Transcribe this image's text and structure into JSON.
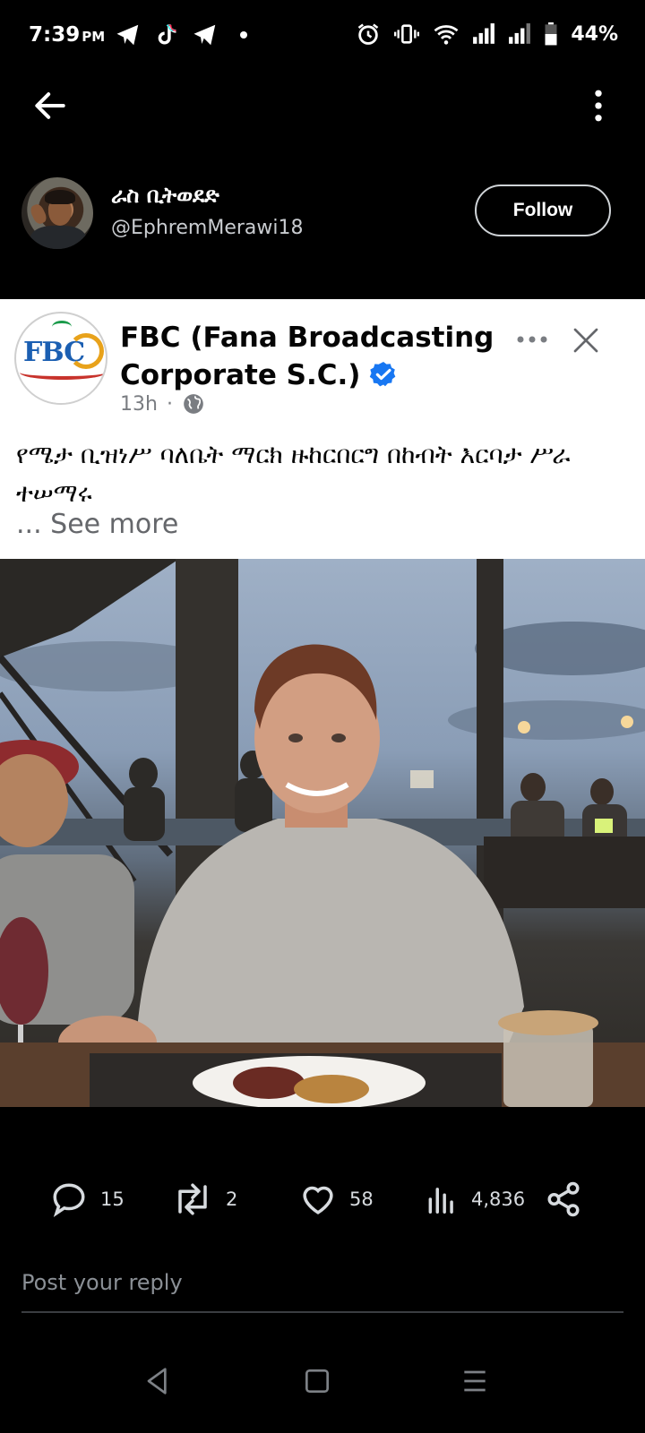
{
  "status_bar": {
    "time": "7:39",
    "ampm": "PM",
    "battery_pct": "44%",
    "icons": [
      "telegram-icon",
      "tiktok-icon",
      "telegram-icon",
      "dot-icon",
      "alarm-icon",
      "vibrate-icon",
      "wifi-icon",
      "signal-icon",
      "signal-icon",
      "battery-icon"
    ]
  },
  "header": {
    "back_icon": "arrow-left-icon",
    "more_icon": "more-vertical-icon"
  },
  "profile": {
    "display_name": "ራስ ቢትወደድ",
    "handle": "@EphremMerawi18",
    "follow_label": "Follow"
  },
  "fb_post": {
    "page_name": "FBC (Fana Broadcasting Corporate S.C.)",
    "time_ago": "13h",
    "separator": "·",
    "audience_icon": "globe-icon",
    "logo_text": "FBC",
    "body_text": "የሜታ ቢዝነሥ ባለቤት ማርክ ዙከርበርግ በከብት እርባታ ሥራ ተሠማሩ",
    "see_more": "... See more",
    "accent_color": "#1877f2"
  },
  "photo": {
    "icon": "photo-image"
  },
  "actions": {
    "replies": "15",
    "reposts": "2",
    "likes": "58",
    "views": "4,836"
  },
  "reply": {
    "placeholder": "Post your reply"
  },
  "colors": {
    "background": "#000000",
    "card_background": "#ffffff",
    "verified_blue": "#1877f2",
    "secondary_text": "#8b9096"
  }
}
